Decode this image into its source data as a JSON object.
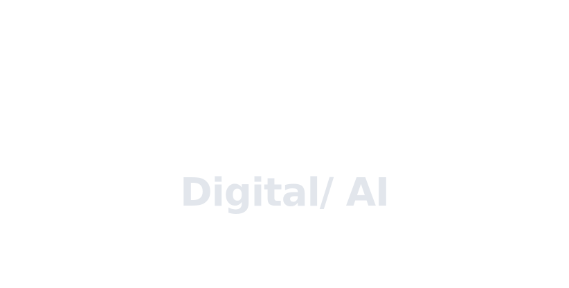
{
  "hero": {
    "watermark_text": "Digital/ AI"
  },
  "colors": {
    "background": "#ffffff",
    "watermark_text": "#e2e6ec"
  }
}
